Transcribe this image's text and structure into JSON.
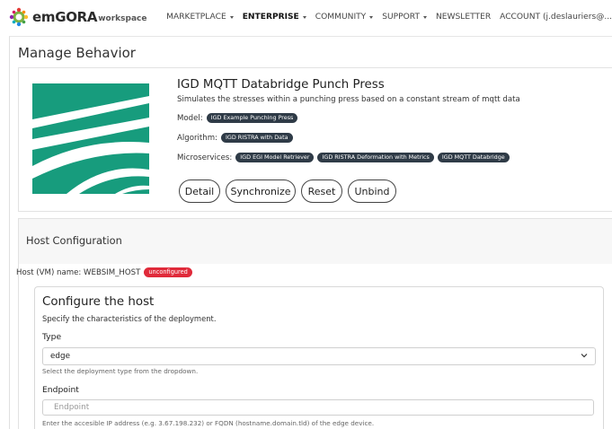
{
  "brand": {
    "name": "emGORA",
    "suffix": "workspace"
  },
  "nav": {
    "items": [
      {
        "label": "MARKETPLACE",
        "dropdown": true,
        "active": false
      },
      {
        "label": "ENTERPRISE",
        "dropdown": true,
        "active": true
      },
      {
        "label": "COMMUNITY",
        "dropdown": true,
        "active": false
      },
      {
        "label": "SUPPORT",
        "dropdown": true,
        "active": false
      },
      {
        "label": "NEWSLETTER",
        "dropdown": false,
        "active": false
      },
      {
        "label": "ACCOUNT (j.deslauriers@...",
        "dropdown": false,
        "active": false
      }
    ]
  },
  "page": {
    "title": "Manage Behavior"
  },
  "behavior": {
    "title": "IGD MQTT Databridge Punch Press",
    "description": "Simulates the stresses within a punching press based on a constant stream of mqtt data",
    "model_label": "Model:",
    "model": "IGD Example Punching Press",
    "algorithm_label": "Algorithm:",
    "algorithm": "IGD RISTRA with Data",
    "microservices_label": "Microservices:",
    "microservices": [
      "IGD EGI Model Retriever",
      "IGD RISTRA Deformation with Metrics",
      "IGD MQTT Databridge"
    ],
    "buttons": {
      "detail": "Detail",
      "synchronize": "Synchronize",
      "reset": "Reset",
      "unbind": "Unbind"
    },
    "thumbnail_icon": "fraunhofer-logo-icon"
  },
  "host": {
    "section_title": "Host Configuration",
    "name_label": "Host (VM) name: WEBSIM_HOST",
    "status": "unconfigured",
    "configure": {
      "title": "Configure the host",
      "subtitle": "Specify the characteristics of the deployment.",
      "type_label": "Type",
      "type_value": "edge",
      "type_help": "Select the deployment type from the dropdown.",
      "endpoint_label": "Endpoint",
      "endpoint_placeholder": "Endpoint",
      "endpoint_help": "Enter the accesible IP address (e.g. 3.67.198.232) or FQDN (hostname.domain.tld) of the edge device."
    }
  },
  "colors": {
    "accent_green": "#179c7d",
    "tag_dark": "#2f3b47",
    "badge_red": "#e02a3a"
  }
}
